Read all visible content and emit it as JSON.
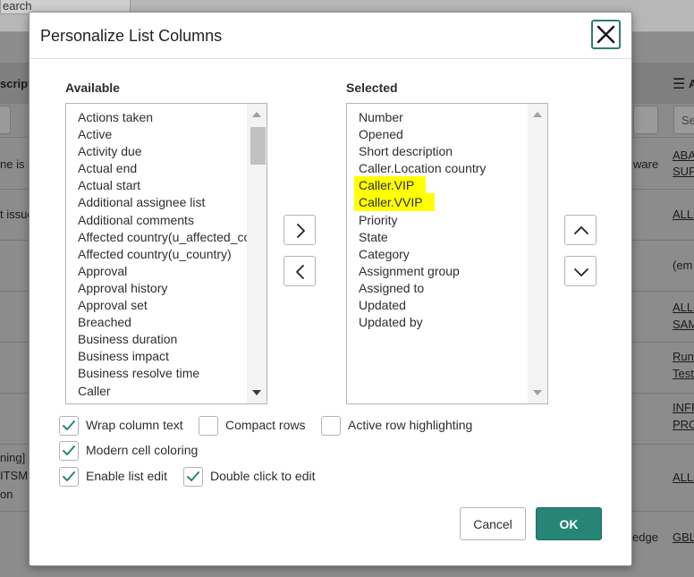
{
  "background": {
    "search_text": "earch",
    "header_left": "scripti",
    "header_right_icon": "hamburger-icon",
    "header_right_text": "A",
    "filter_right": "Se",
    "rows": [
      {
        "left": "ne is s",
        "mid": "ware",
        "right1": "ABA",
        "right2": "SUP"
      },
      {
        "left": "t issue",
        "mid": "",
        "right1": "ALL-",
        "right2": ""
      },
      {
        "left": "",
        "mid": "",
        "right1": "(em",
        "right2": ""
      },
      {
        "left": "",
        "mid": "",
        "right1": "ALL-",
        "right2": "SAM"
      },
      {
        "left": "",
        "mid": "",
        "right1": "Run",
        "right2": "Test"
      },
      {
        "left": "",
        "mid": "",
        "right1": "INFR",
        "right2": "PRO"
      },
      {
        "left": "ning]",
        "left2": "ITSM",
        "left3": "on",
        "mid": "",
        "right1": "ALL-",
        "right2": ""
      },
      {
        "left": "",
        "mid": "edge",
        "right1": "GBL",
        "right2": ""
      }
    ]
  },
  "dialog": {
    "title": "Personalize List Columns",
    "close_icon": "close-icon",
    "available_label": "Available",
    "selected_label": "Selected",
    "available_items": [
      "Actions taken",
      "Active",
      "Activity due",
      "Actual end",
      "Actual start",
      "Additional assignee list",
      "Additional comments",
      "Affected country(u_affected_co",
      "Affected country(u_country)",
      "Approval",
      "Approval history",
      "Approval set",
      "Breached",
      "Business duration",
      "Business impact",
      "Business resolve time",
      "Caller"
    ],
    "selected_items": [
      "Number",
      "Opened",
      "Short description",
      "Caller.Location country",
      "Caller.VIP",
      "Caller.VVIP",
      "Priority",
      "State",
      "Category",
      "Assignment group",
      "Assigned to",
      "Updated",
      "Updated by"
    ],
    "highlighted_items": [
      "Caller.VIP",
      "Caller.VVIP"
    ],
    "highlight_color": "#ffff00",
    "add_icon": "chevron-right-icon",
    "remove_icon": "chevron-left-icon",
    "move_up_icon": "chevron-up-icon",
    "move_down_icon": "chevron-down-icon",
    "options": {
      "wrap_column_text": {
        "label": "Wrap column text",
        "checked": true
      },
      "compact_rows": {
        "label": "Compact rows",
        "checked": false
      },
      "active_row_highlighting": {
        "label": "Active row highlighting",
        "checked": false
      },
      "modern_cell_coloring": {
        "label": "Modern cell coloring",
        "checked": true
      },
      "enable_list_edit": {
        "label": "Enable list edit",
        "checked": true
      },
      "double_click_to_edit": {
        "label": "Double click to edit",
        "checked": true
      }
    },
    "cancel_label": "Cancel",
    "ok_label": "OK",
    "accent_color": "#278576"
  }
}
